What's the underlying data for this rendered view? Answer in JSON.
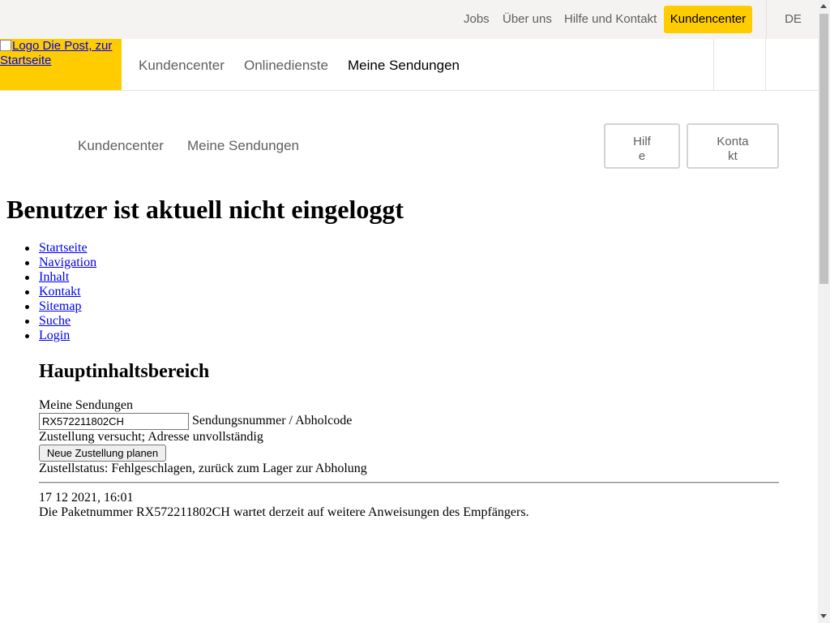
{
  "utility_bar": {
    "links": [
      "Jobs",
      "Über uns",
      "Hilfe und Kontakt"
    ],
    "customer_center": "Kundencenter",
    "language": "DE",
    "accent_color": "#ffcc00"
  },
  "header": {
    "logo_alt": "Logo Die Post, zur Startseite",
    "nav": [
      "Kundencenter",
      "Onlinedienste",
      "Meine Sendungen"
    ]
  },
  "breadcrumb": {
    "items": [
      "Kundencenter",
      "Meine Sendungen"
    ]
  },
  "side_buttons": {
    "help": "Hilfe",
    "contact": "Kontakt"
  },
  "page_title": "Benutzer ist aktuell nicht eingeloggt",
  "skip_links": [
    "Startseite",
    "Navigation",
    "Inhalt",
    "Kontakt",
    "Sitemap",
    "Suche",
    "Login"
  ],
  "main": {
    "heading": "Hauptinhaltsbereich",
    "section_label": "Meine Sendungen",
    "tracking_input_value": "RX572211802CH",
    "tracking_input_label": "Sendungsnummer / Abholcode",
    "delivery_note": "Zustellung versucht; Adresse unvollständig",
    "plan_button": "Neue Zustellung planen",
    "status": "Zustellstatus: Fehlgeschlagen, zurück zum Lager zur Abholung",
    "event_datetime": "17 12 2021, 16:01",
    "event_text": "Die Paketnummer RX572211802CH wartet derzeit auf weitere Anweisungen des Empfängers."
  }
}
